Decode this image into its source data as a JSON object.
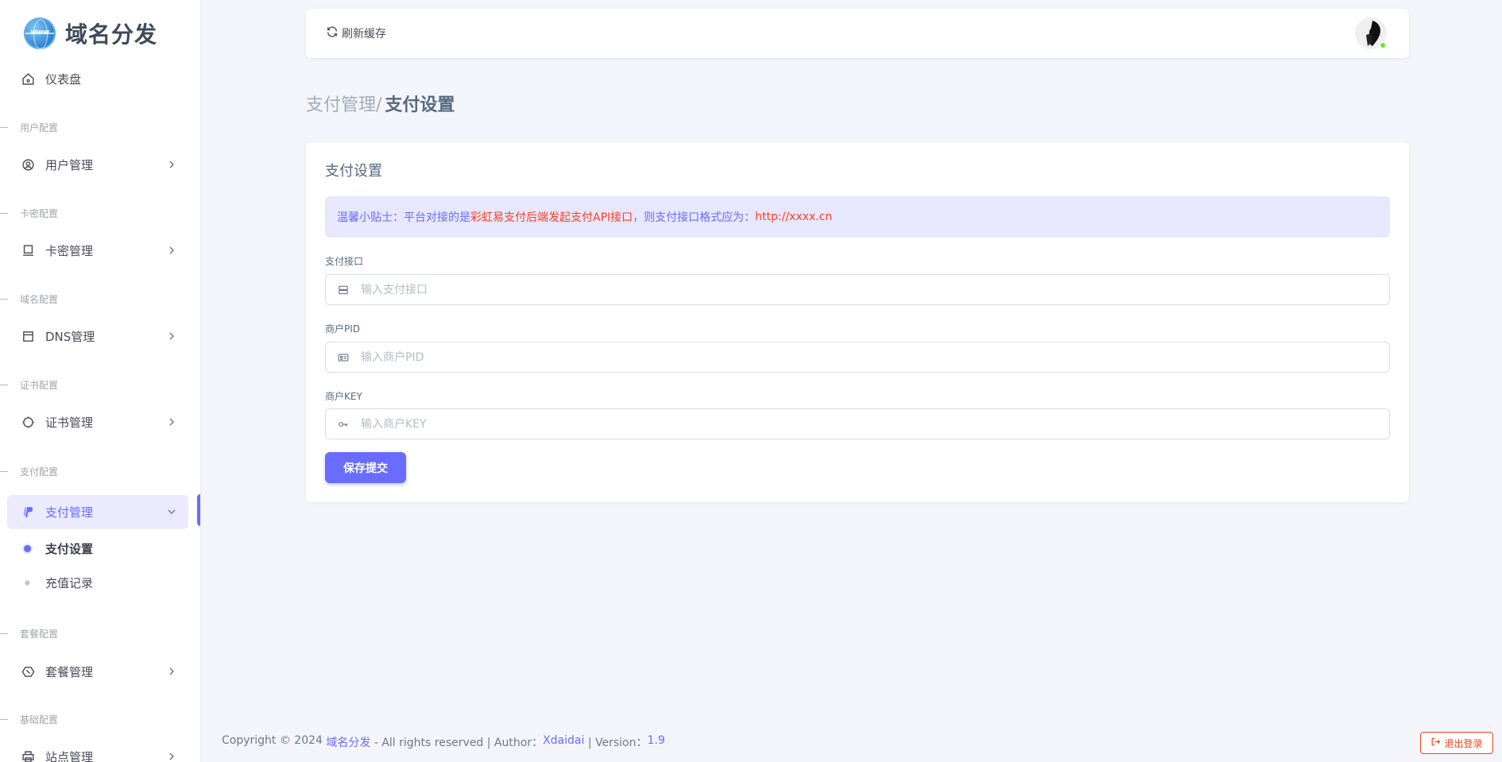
{
  "app": {
    "title": "域名分发",
    "logo_badge": "www"
  },
  "colors": {
    "accent": "#696cff",
    "danger": "#ff3e1d",
    "online": "#71dd37"
  },
  "sidebar": {
    "dashboard": {
      "label": "仪表盘",
      "icon": "home-icon"
    },
    "sections": [
      {
        "title": "用户配置",
        "item": {
          "label": "用户管理",
          "icon": "user-circle-icon"
        }
      },
      {
        "title": "卡密配置",
        "item": {
          "label": "卡密管理",
          "icon": "laptop-icon"
        }
      },
      {
        "title": "域名配置",
        "item": {
          "label": "DNS管理",
          "icon": "window-icon"
        }
      },
      {
        "title": "证书配置",
        "item": {
          "label": "证书管理",
          "icon": "badge-icon"
        }
      },
      {
        "title": "支付配置",
        "item": {
          "label": "支付管理",
          "icon": "paypal-icon",
          "expanded": true,
          "children": [
            {
              "label": "支付设置",
              "active": true
            },
            {
              "label": "充值记录",
              "active": false
            }
          ]
        }
      },
      {
        "title": "套餐配置",
        "item": {
          "label": "套餐管理",
          "icon": "cube-icon"
        }
      },
      {
        "title": "基础配置",
        "item": {
          "label": "站点管理",
          "icon": "printer-icon"
        }
      }
    ]
  },
  "topbar": {
    "refresh_label": "刷新缓存"
  },
  "breadcrumb": {
    "parent": "支付管理/",
    "current": "支付设置"
  },
  "card": {
    "title": "支付设置",
    "alert": {
      "prefix": "温馨小贴士：平台对接的是",
      "highlight": "彩虹易支付后端发起支付API接口",
      "middle": "，则支付接口格式应为：",
      "url": "http://xxxx.cn"
    },
    "fields": {
      "api": {
        "label": "支付接口",
        "placeholder": "输入支付接口",
        "value": ""
      },
      "pid": {
        "label": "商户PID",
        "placeholder": "输入商户PID",
        "value": ""
      },
      "key": {
        "label": "商户KEY",
        "placeholder": "输入商户KEY",
        "value": ""
      }
    },
    "submit_label": "保存提交"
  },
  "footer": {
    "copyright": "Copyright © 2024 ",
    "site": "域名分发",
    "rights": " - All rights reserved | Author：",
    "author": "Xdaidai",
    "version_label": " | Version：",
    "version": "1.9"
  },
  "logout_label": "退出登录"
}
